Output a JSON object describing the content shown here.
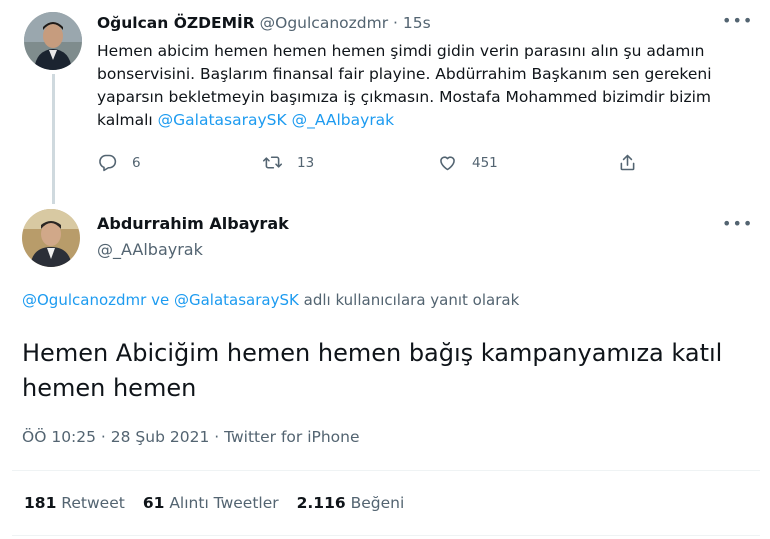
{
  "parent_tweet": {
    "author_name": "Oğulcan ÖZDEMİR",
    "handle": "@Ogulcanozdmr",
    "separator": "·",
    "time": "15s",
    "body_text": "Hemen abicim hemen hemen hemen şimdi gidin verin parasını alın şu adamın bonservisini. Başlarım finansal fair playine. Abdürrahim Başkanım sen gerekeni yaparsın bekletmeyin başımıza iş çıkmasın. Mostafa Mohammed bizimdir bizim kalmalı",
    "mention_1": "@GalatasaraySK",
    "mention_2": "@_AAlbayrak",
    "more_label": "•••",
    "reply_count": "6",
    "retweet_count": "13",
    "like_count": "451",
    "icons": [
      "reply-icon",
      "retweet-icon",
      "like-icon",
      "share-icon"
    ]
  },
  "main_tweet": {
    "author_name": "Abdurrahim Albayrak",
    "handle": "@_AAlbayrak",
    "more_label": "•••",
    "reply_to_1": "@Ogulcanozdmr",
    "reply_and": "ve",
    "reply_to_2": "@GalatasaraySK",
    "reply_suffix": "adlı kullanıcılara yanıt olarak",
    "text": "Hemen Abiciğim hemen hemen bağış kampanyamıza katıl hemen hemen",
    "timestamp": "ÖÖ 10:25 · 28 Şub 2021 · Twitter for iPhone",
    "stats": {
      "retweets_value": "181",
      "retweets_label": "Retweet",
      "quotes_value": "61",
      "quotes_label": "Alıntı Tweetler",
      "likes_value": "2.116",
      "likes_label": "Beğeni"
    }
  },
  "colors": {
    "link": "#1d9bf0",
    "secondary_text": "#536471",
    "primary_text": "#0f1419",
    "thread_line": "#cfd9de"
  }
}
